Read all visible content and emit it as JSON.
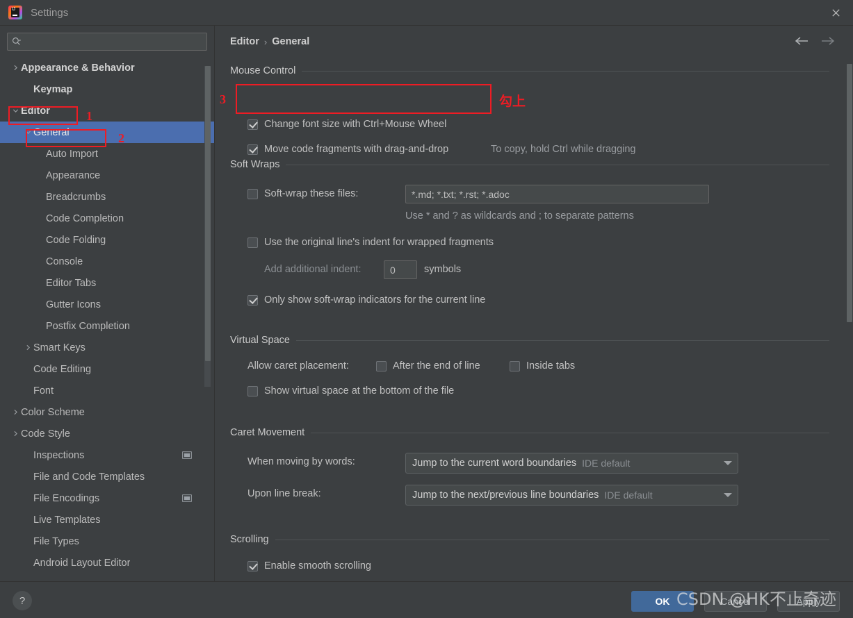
{
  "window": {
    "title": "Settings",
    "logo_icon": "intellij-idea-logo",
    "close_icon": "close-icon"
  },
  "search": {
    "value": "",
    "placeholder": "",
    "icon": "search-icon"
  },
  "sidebar": {
    "items": [
      {
        "label": "Appearance & Behavior",
        "indent": 0,
        "twisty": "chevron-right-icon",
        "bold": true,
        "selected": false,
        "badge": false
      },
      {
        "label": "Keymap",
        "indent": 1,
        "twisty": "",
        "bold": true,
        "selected": false,
        "badge": false
      },
      {
        "label": "Editor",
        "indent": 0,
        "twisty": "chevron-down-icon",
        "bold": true,
        "selected": false,
        "badge": false
      },
      {
        "label": "General",
        "indent": 1,
        "twisty": "chevron-down-icon",
        "bold": false,
        "selected": true,
        "badge": false
      },
      {
        "label": "Auto Import",
        "indent": 2,
        "twisty": "",
        "bold": false,
        "selected": false,
        "badge": false
      },
      {
        "label": "Appearance",
        "indent": 2,
        "twisty": "",
        "bold": false,
        "selected": false,
        "badge": false
      },
      {
        "label": "Breadcrumbs",
        "indent": 2,
        "twisty": "",
        "bold": false,
        "selected": false,
        "badge": false
      },
      {
        "label": "Code Completion",
        "indent": 2,
        "twisty": "",
        "bold": false,
        "selected": false,
        "badge": false
      },
      {
        "label": "Code Folding",
        "indent": 2,
        "twisty": "",
        "bold": false,
        "selected": false,
        "badge": false
      },
      {
        "label": "Console",
        "indent": 2,
        "twisty": "",
        "bold": false,
        "selected": false,
        "badge": false
      },
      {
        "label": "Editor Tabs",
        "indent": 2,
        "twisty": "",
        "bold": false,
        "selected": false,
        "badge": false
      },
      {
        "label": "Gutter Icons",
        "indent": 2,
        "twisty": "",
        "bold": false,
        "selected": false,
        "badge": false
      },
      {
        "label": "Postfix Completion",
        "indent": 2,
        "twisty": "",
        "bold": false,
        "selected": false,
        "badge": false
      },
      {
        "label": "Smart Keys",
        "indent": 1,
        "twisty": "chevron-right-icon",
        "bold": false,
        "selected": false,
        "badge": false
      },
      {
        "label": "Code Editing",
        "indent": 1,
        "twisty": "",
        "bold": false,
        "selected": false,
        "badge": false
      },
      {
        "label": "Font",
        "indent": 1,
        "twisty": "",
        "bold": false,
        "selected": false,
        "badge": false
      },
      {
        "label": "Color Scheme",
        "indent": 0,
        "twisty": "chevron-right-icon",
        "bold": false,
        "selected": false,
        "badge": false
      },
      {
        "label": "Code Style",
        "indent": 0,
        "twisty": "chevron-right-icon",
        "bold": false,
        "selected": false,
        "badge": false
      },
      {
        "label": "Inspections",
        "indent": 1,
        "twisty": "",
        "bold": false,
        "selected": false,
        "badge": true
      },
      {
        "label": "File and Code Templates",
        "indent": 1,
        "twisty": "",
        "bold": false,
        "selected": false,
        "badge": false
      },
      {
        "label": "File Encodings",
        "indent": 1,
        "twisty": "",
        "bold": false,
        "selected": false,
        "badge": true
      },
      {
        "label": "Live Templates",
        "indent": 1,
        "twisty": "",
        "bold": false,
        "selected": false,
        "badge": false
      },
      {
        "label": "File Types",
        "indent": 1,
        "twisty": "",
        "bold": false,
        "selected": false,
        "badge": false
      },
      {
        "label": "Android Layout Editor",
        "indent": 1,
        "twisty": "",
        "bold": false,
        "selected": false,
        "badge": false
      }
    ]
  },
  "breadcrumb": {
    "root": "Editor",
    "separator": "›",
    "leaf": "General"
  },
  "nav": {
    "back_icon": "arrow-left-icon",
    "forward_icon": "arrow-right-icon"
  },
  "sections": {
    "mouse_control": {
      "title": "Mouse Control",
      "change_font_size": {
        "label": "Change font size with Ctrl+Mouse Wheel",
        "checked": true
      },
      "move_code_fragments": {
        "label": "Move code fragments with drag-and-drop",
        "checked": true
      },
      "drag_hint": "To copy, hold Ctrl while dragging"
    },
    "soft_wraps": {
      "title": "Soft Wraps",
      "soft_wrap_files": {
        "label": "Soft-wrap these files:",
        "checked": false
      },
      "soft_wrap_files_value": "*.md; *.txt; *.rst; *.adoc",
      "wildcards_hint": "Use * and ? as wildcards and ; to separate patterns",
      "original_indent": {
        "label": "Use the original line's indent for wrapped fragments",
        "checked": false
      },
      "add_indent_label": "Add additional indent:",
      "add_indent_value": "0",
      "symbols_label": "symbols",
      "only_show_indicators": {
        "label": "Only show soft-wrap indicators for the current line",
        "checked": true
      }
    },
    "virtual_space": {
      "title": "Virtual Space",
      "allow_caret_label": "Allow caret placement:",
      "after_end_of_line": {
        "label": "After the end of line",
        "checked": false
      },
      "inside_tabs": {
        "label": "Inside tabs",
        "checked": false
      },
      "show_virtual_space": {
        "label": "Show virtual space at the bottom of the file",
        "checked": false
      }
    },
    "caret_movement": {
      "title": "Caret Movement",
      "when_moving_label": "When moving by words:",
      "when_moving_value": "Jump to the current word boundaries",
      "when_moving_sub": "IDE default",
      "upon_line_break_label": "Upon line break:",
      "upon_line_break_value": "Jump to the next/previous line boundaries",
      "upon_line_break_sub": "IDE default",
      "dropdown_icon": "chevron-down-icon"
    },
    "scrolling": {
      "title": "Scrolling",
      "enable_smooth": {
        "label": "Enable smooth scrolling",
        "checked": true
      }
    }
  },
  "footer": {
    "help_icon": "question-mark-icon",
    "help_label": "?",
    "ok_label": "OK",
    "cancel_label": "Cancel",
    "apply_label": "Apply"
  },
  "annotations": {
    "num1": "1",
    "num2": "2",
    "num3": "3",
    "note_cn": "勾上",
    "color": "#ee1c24"
  },
  "watermark": {
    "text": "CSDN @HK不止奇迹"
  }
}
